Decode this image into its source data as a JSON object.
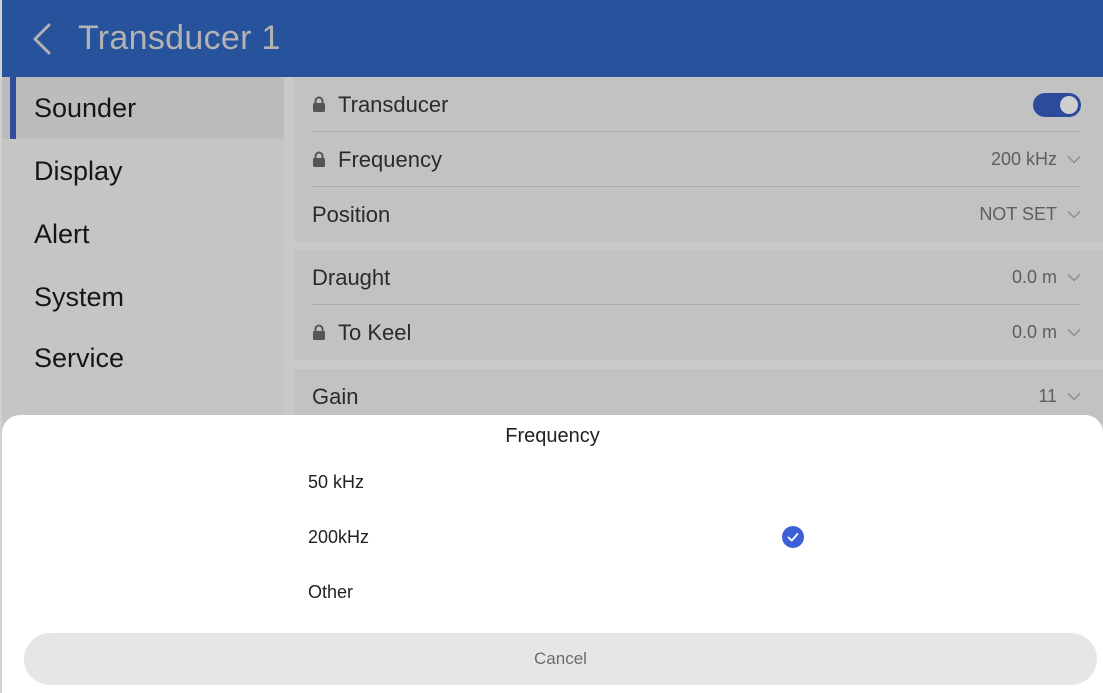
{
  "header": {
    "title": "Transducer 1",
    "back_icon": "chevron-left-icon",
    "background": "#27529c"
  },
  "sidebar": {
    "items": [
      {
        "label": "Sounder",
        "active": true
      },
      {
        "label": "Display",
        "active": false
      },
      {
        "label": "Alert",
        "active": false
      },
      {
        "label": "System",
        "active": false
      },
      {
        "label": "Service",
        "active": false
      }
    ]
  },
  "settings": {
    "transducer": {
      "label": "Transducer",
      "locked": true,
      "toggle_on": true
    },
    "frequency": {
      "label": "Frequency",
      "locked": true,
      "value": "200 kHz"
    },
    "position": {
      "label": "Position",
      "locked": false,
      "value": "NOT SET"
    },
    "draught": {
      "label": "Draught",
      "locked": false,
      "value": "0.0 m"
    },
    "to_keel": {
      "label": "To Keel",
      "locked": true,
      "value": "0.0 m"
    },
    "gain": {
      "label": "Gain",
      "locked": false,
      "value": "11"
    }
  },
  "sheet": {
    "title": "Frequency",
    "options": [
      {
        "label": "50 kHz",
        "selected": false
      },
      {
        "label": "200kHz",
        "selected": true
      },
      {
        "label": "Other",
        "selected": false
      }
    ],
    "cancel_label": "Cancel",
    "check_color": "#3f5fd9"
  },
  "colors": {
    "accent": "#2d4b9d",
    "sidebar_indicator": "#2f4d9a"
  }
}
